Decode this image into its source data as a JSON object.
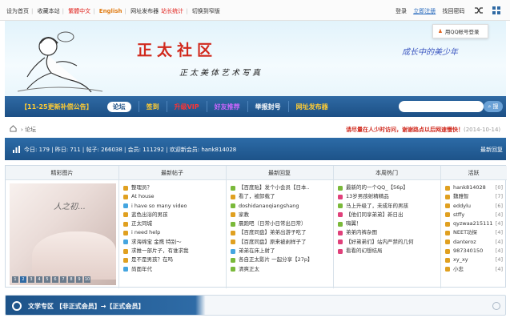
{
  "topbar": {
    "links_left": [
      {
        "label": "设为首页",
        "color": "default"
      },
      {
        "label": "收藏本站",
        "color": "default"
      },
      {
        "label": "繁體中文",
        "color": "red"
      },
      {
        "label": "English",
        "color": "orange"
      },
      {
        "label": "网址发布器",
        "color": "default"
      },
      {
        "label": "站长统计",
        "color": "red"
      },
      {
        "label": "切换到窄版",
        "color": "default"
      }
    ],
    "links_right": [
      "登录",
      "立即注册",
      "找回密码"
    ],
    "qq_login": "用QQ帐号登录"
  },
  "banner": {
    "title": "正太社区",
    "subtitle": "正太美体艺术写真",
    "slogan": "成长中的美少年"
  },
  "nav": {
    "notice": "【11-25更新补偿公告】",
    "items": [
      {
        "label": "论坛",
        "color": "#1c4f85",
        "active": true
      },
      {
        "label": "签到",
        "color": "#ffcc33"
      },
      {
        "label": "升级VIP",
        "color": "#ff3333"
      },
      {
        "label": "好友推荐",
        "color": "#cc66ff"
      },
      {
        "label": "举报封号",
        "color": "#ffffff"
      },
      {
        "label": "网址发布器",
        "color": "#ffcc33"
      }
    ],
    "search_button": "搜"
  },
  "breadcrumb": {
    "current": "论坛",
    "visit_notice": "请尽量在人少时访问，谢谢路点以后网速慢快！",
    "visit_date": "(2014-10-14)"
  },
  "stats": {
    "text": "今日: 179 | 昨日: 711 | 帖子: 266038 | 会员: 111292 | 欢迎新会员: hank814028",
    "latest": "最新回复"
  },
  "panel": {
    "headers": [
      "精彩图片",
      "最新帖子",
      "最新回复",
      "本周热门",
      "活跃"
    ],
    "photo_text": "人之初...",
    "slider_dots": [
      "1",
      "2",
      "3",
      "4",
      "5",
      "6",
      "7",
      "8",
      "9",
      "10"
    ],
    "new_posts": [
      "整理员？",
      "At house",
      "i have so many video",
      "蓝色出浴的男孩",
      "正太同城",
      "i need help",
      "求海绵宝 金鹰 特别～",
      "求推一部片子，有谁求我",
      "是不是男孩？在吗",
      "尚面年代"
    ],
    "new_replies": [
      "【百度贴】发个小会员【日本..",
      "看了，被卸载了",
      "doshidanaoqiangshang",
      "家教",
      "晨跑吧（日常小日常出日常）",
      "【百度同盘】弟弟出游子吃了",
      "【百度同盘】原来被剥样子了",
      "弟弟在床上射了",
      "各自正太影片 一起分享【27p】",
      "清爽正太"
    ],
    "hot_week": [
      "最新的的一个QQ_【56p】",
      "13岁男孩射精精品",
      "马上升级了，未成年的男孩",
      "【他们同享弟弟】新日出",
      "嗨翼！",
      "弟弟内裤杂图",
      "【好弟弟们】站内严禁的几何",
      "看看的幻想结局"
    ],
    "active_users": [
      {
        "name": "hank814028",
        "val": "[0]"
      },
      {
        "name": "魏雅智",
        "val": "[7]"
      },
      {
        "name": "eddylu",
        "val": "[6]"
      },
      {
        "name": "stffy",
        "val": "[4]"
      },
      {
        "name": "qyzwaa215111",
        "val": "[4]"
      },
      {
        "name": "NEET功探",
        "val": "[4]"
      },
      {
        "name": "danteroz",
        "val": "[4]"
      },
      {
        "name": "987340150",
        "val": "[4]"
      },
      {
        "name": "xy_xy",
        "val": "[4]"
      },
      {
        "name": "小忠",
        "val": "[4]"
      }
    ]
  },
  "section": {
    "title": "文学专区 【非正式会员】→【正式会员】"
  },
  "colors": {
    "brand_blue": "#1c4f85",
    "accent_red": "#d12a1e",
    "bullet_colors": [
      "#e0a020",
      "#44a5e0",
      "#7ab93a",
      "#e0407a",
      "#c9c9c9"
    ]
  }
}
